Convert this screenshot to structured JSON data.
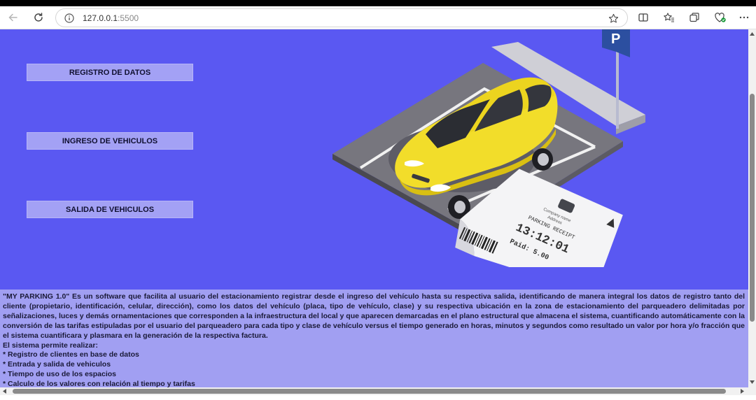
{
  "browser": {
    "url_host": "127.0.0.1",
    "url_port": ":5500"
  },
  "nav": {
    "registro": "REGISTRO DE DATOS",
    "ingreso": "INGRESO DE VEHICULOS",
    "salida": "SALIDA DE VEHICULOS"
  },
  "ticket": {
    "company": "Company name",
    "address": "Address",
    "title": "PARKING RECEIPT",
    "time": "13:12:01",
    "paid": "Paid: 5.00"
  },
  "description": {
    "paragraph": "\"MY PARKING 1.0\" Es un software que facilita al usuario del estacionamiento registrar desde el ingreso del vehículo hasta su respectiva salida, identificando de manera integral los datos de registro tanto del cliente (propietario, identificación, celular, dirección), como los datos del vehículo (placa, tipo de vehículo, clase) y su respectiva ubicación en la zona de estacionamiento del parqueadero delimitadas por señalizaciones, luces y demás ornamentaciones que corresponden a la infraestructura del local y que aparecen demarcadas en el plano estructural que almacena el sistema, cuantificando automáticamente con la conversión de las tarifas estipuladas por el usuario del parqueadero para cada tipo y clase de vehículo versus el tiempo generado en horas, minutos y segundos como resultado un valor por hora y/o fracción que el sistema cuantificara y plasmara en la generación de la respectiva factura.",
    "heading": "El sistema permite realizar:",
    "items": [
      "* Registro de clientes en base de datos",
      "* Entrada y salida de vehiculos",
      "* Tiempo de uso de los espacios",
      "* Calculo de los valores con relación al tiempo y tarifas"
    ]
  },
  "colors": {
    "hero_bg": "#5a58f2",
    "button_bg": "#a3a1f5",
    "desc_bg": "#a19ff2",
    "car": "#f2dd2a"
  },
  "icons": [
    "back-arrow-icon",
    "refresh-icon",
    "info-icon",
    "star-icon",
    "split-screen-icon",
    "favorites-icon",
    "collections-icon",
    "browser-essentials-icon",
    "more-icon",
    "parking-sign-icon"
  ]
}
